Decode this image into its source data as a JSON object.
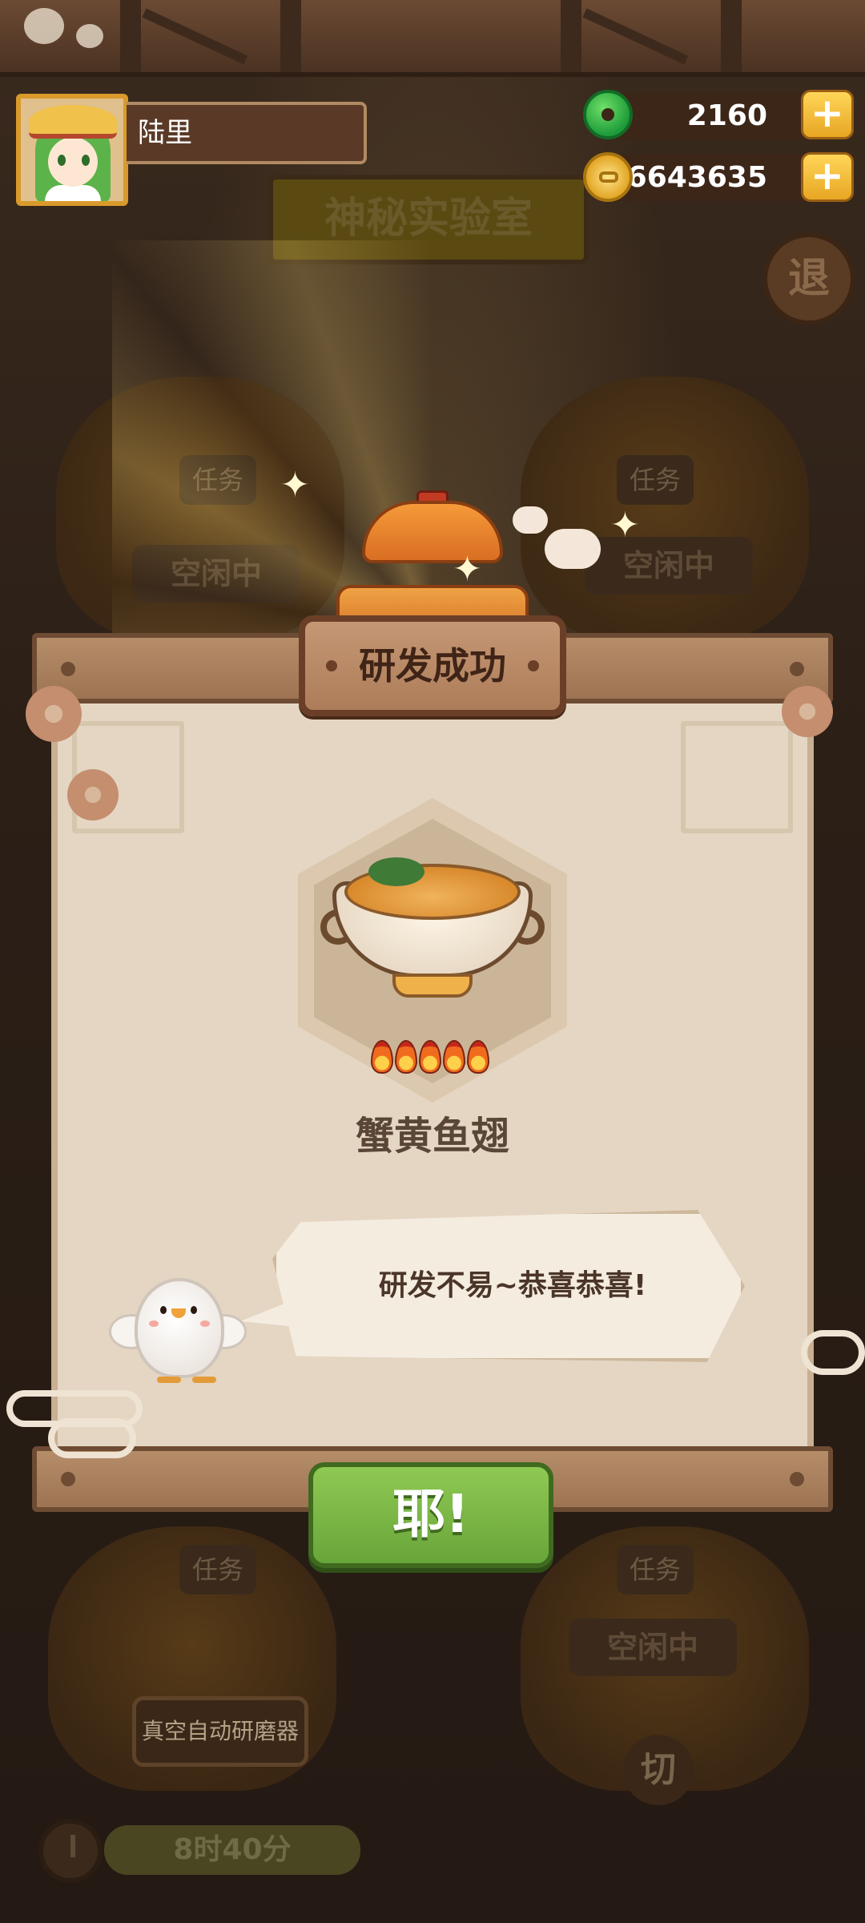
{
  "player": {
    "name": "陆里"
  },
  "currency": {
    "jade": "2160",
    "gold": "66643635",
    "add_symbol": "+"
  },
  "background": {
    "room_title": "神秘实验室",
    "exit_label": "退",
    "task_label": "任务",
    "idle_label": "空闲中",
    "machine_name": "真空自动研磨器",
    "switch_label": "切",
    "timer": "8时40分"
  },
  "modal": {
    "title": "研发成功",
    "dish_name": "蟹黄鱼翅",
    "flame_rating": 5,
    "message": "研发不易~恭喜恭喜!",
    "confirm_label": "耶!"
  },
  "icons": {
    "jade": "jade-coin-icon",
    "gold": "gold-coin-icon",
    "sparkle": "sparkle-icon",
    "flame": "flame-icon"
  },
  "colors": {
    "confirm_green": "#7ab847",
    "frame_brown": "#9d7453",
    "paper": "#e4d6c2"
  }
}
